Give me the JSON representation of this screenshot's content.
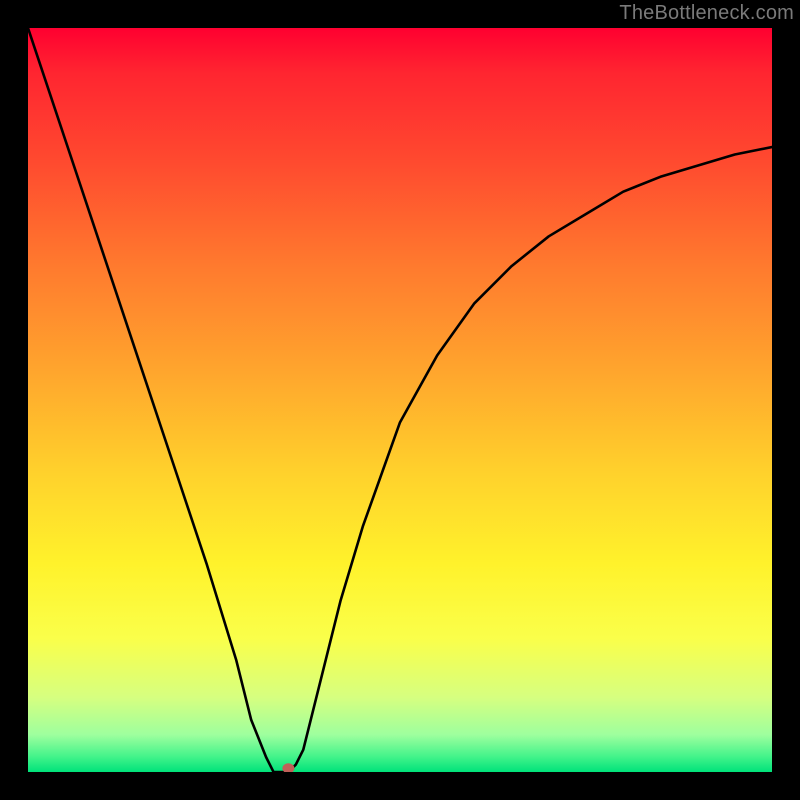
{
  "watermark": "TheBottleneck.com",
  "colors": {
    "frame": "#000000",
    "curve": "#000000",
    "marker": "#c06058",
    "gradient_stops": [
      "#ff0030",
      "#ff2530",
      "#ff4a2f",
      "#ff7a2e",
      "#ffa52d",
      "#ffd22c",
      "#fff22b",
      "#faff4a",
      "#d6ff80",
      "#9eff9e",
      "#41f38a",
      "#00e27a"
    ]
  },
  "chart_data": {
    "type": "line",
    "title": "",
    "xlabel": "",
    "ylabel": "",
    "xlim": [
      0,
      100
    ],
    "ylim": [
      0,
      100
    ],
    "grid": false,
    "legend": false,
    "annotations": [
      "TheBottleneck.com"
    ],
    "x": [
      0,
      5,
      10,
      15,
      20,
      24,
      28,
      30,
      32,
      33,
      34,
      35,
      36,
      37,
      38,
      40,
      42,
      45,
      50,
      55,
      60,
      65,
      70,
      75,
      80,
      85,
      90,
      95,
      100
    ],
    "values": [
      100,
      85,
      70,
      55,
      40,
      28,
      15,
      7,
      2,
      0,
      0,
      0,
      1,
      3,
      7,
      15,
      23,
      33,
      47,
      56,
      63,
      68,
      72,
      75,
      78,
      80,
      81.5,
      83,
      84
    ],
    "series": [
      {
        "name": "curve",
        "x_key": "x",
        "y_key": "values"
      }
    ],
    "marker": {
      "x": 35,
      "y": 0.5,
      "name": "minimum-point"
    }
  }
}
